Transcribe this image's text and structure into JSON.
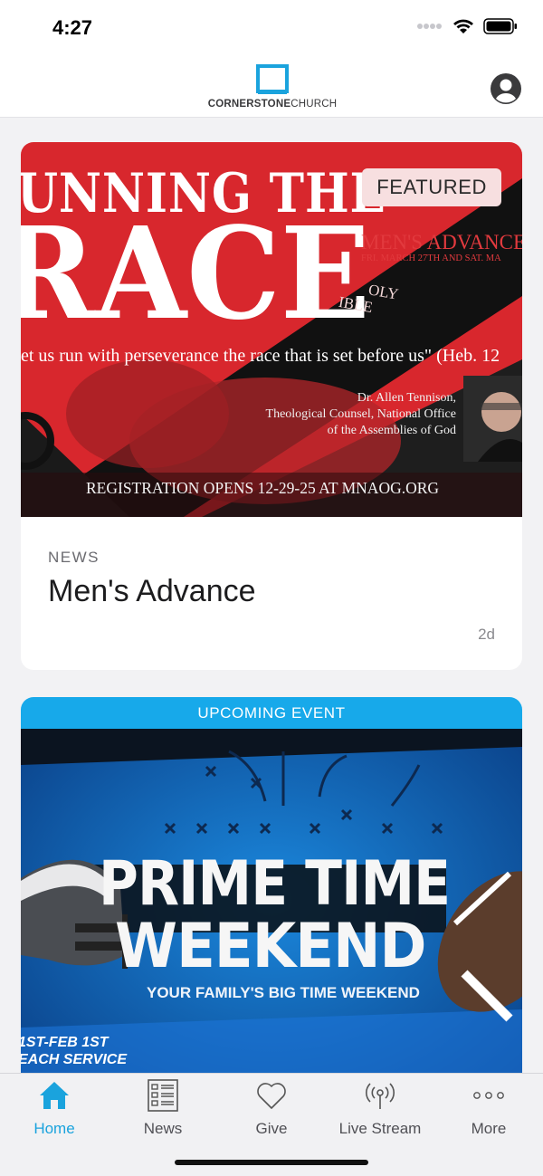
{
  "status": {
    "time": "4:27"
  },
  "header": {
    "logo_bold": "CORNERSTONE",
    "logo_light": "CHURCH"
  },
  "colors": {
    "accent": "#1aa3dd",
    "event_bar": "#17a9ea",
    "featured_red": "#d8272d",
    "event_blue": "#0f64b7"
  },
  "cards": [
    {
      "badge": "FEATURED",
      "hero": {
        "headline_1": "UNNING THE",
        "headline_2": "RACE",
        "event_title": "MEN'S ADVANCE",
        "event_dates": "FRI. MARCH 27TH AND SAT. MA",
        "bible_text_1": "OLY",
        "bible_text_2": "IBLE",
        "quote": "et us run with perseverance the race that is set before us\" (Heb. 12",
        "speaker_name": "Dr. Allen Tennison,",
        "speaker_role_1": "Theological Counsel, National Office",
        "speaker_role_2": "of the Assemblies of God",
        "registration": "REGISTRATION OPENS 12-29-25 AT MNAOG.ORG"
      },
      "category": "NEWS",
      "title": "Men's Advance",
      "age": "2d"
    },
    {
      "banner": "UPCOMING EVENT",
      "hero": {
        "headline_1": "PRIME TIME",
        "headline_2": "WEEKEND",
        "tagline": "YOUR FAMILY'S BIG TIME WEEKEND",
        "dates": "1ST-FEB 1ST",
        "service": "EACH SERVICE"
      }
    }
  ],
  "tabs": [
    {
      "label": "Home",
      "icon": "home-icon",
      "active": true
    },
    {
      "label": "News",
      "icon": "news-icon",
      "active": false
    },
    {
      "label": "Give",
      "icon": "heart-icon",
      "active": false
    },
    {
      "label": "Live Stream",
      "icon": "broadcast-icon",
      "active": false
    },
    {
      "label": "More",
      "icon": "more-icon",
      "active": false
    }
  ]
}
